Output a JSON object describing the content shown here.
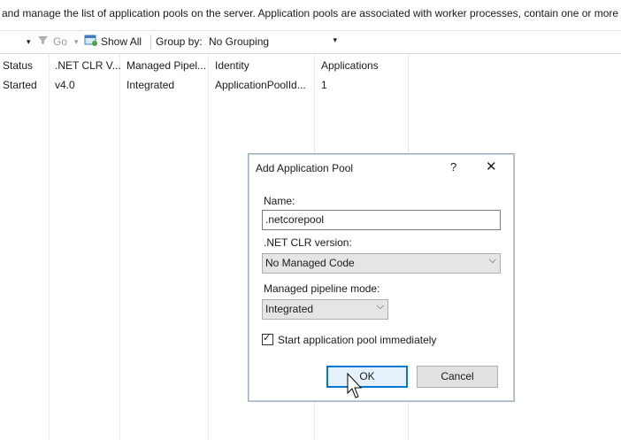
{
  "description": "and manage the list of application pools on the server. Application pools are associated with worker processes, contain one or more a",
  "toolbar": {
    "dropdown_arrow": "▾",
    "go_label": "Go",
    "show_all_label": "Show All",
    "group_by_label": "Group by:",
    "group_by_value": "No Grouping"
  },
  "grid": {
    "columns": [
      "Status",
      ".NET CLR V...",
      "Managed Pipel...",
      "Identity",
      "Applications"
    ],
    "rows": [
      [
        "Started",
        "v4.0",
        "Integrated",
        "ApplicationPoolId...",
        "1"
      ]
    ]
  },
  "dialog": {
    "title": "Add Application Pool",
    "help": "?",
    "close": "✕",
    "name_label": "Name:",
    "name_value": ".netcorepool",
    "clr_label": ".NET CLR version:",
    "clr_value": "No Managed Code",
    "pipeline_label": "Managed pipeline mode:",
    "pipeline_value": "Integrated",
    "start_label": "Start application pool immediately",
    "start_checked": true,
    "ok_label": "OK",
    "cancel_label": "Cancel"
  },
  "colors": {
    "accent": "#0078d7",
    "dialog_border": "#9fb1c7"
  }
}
